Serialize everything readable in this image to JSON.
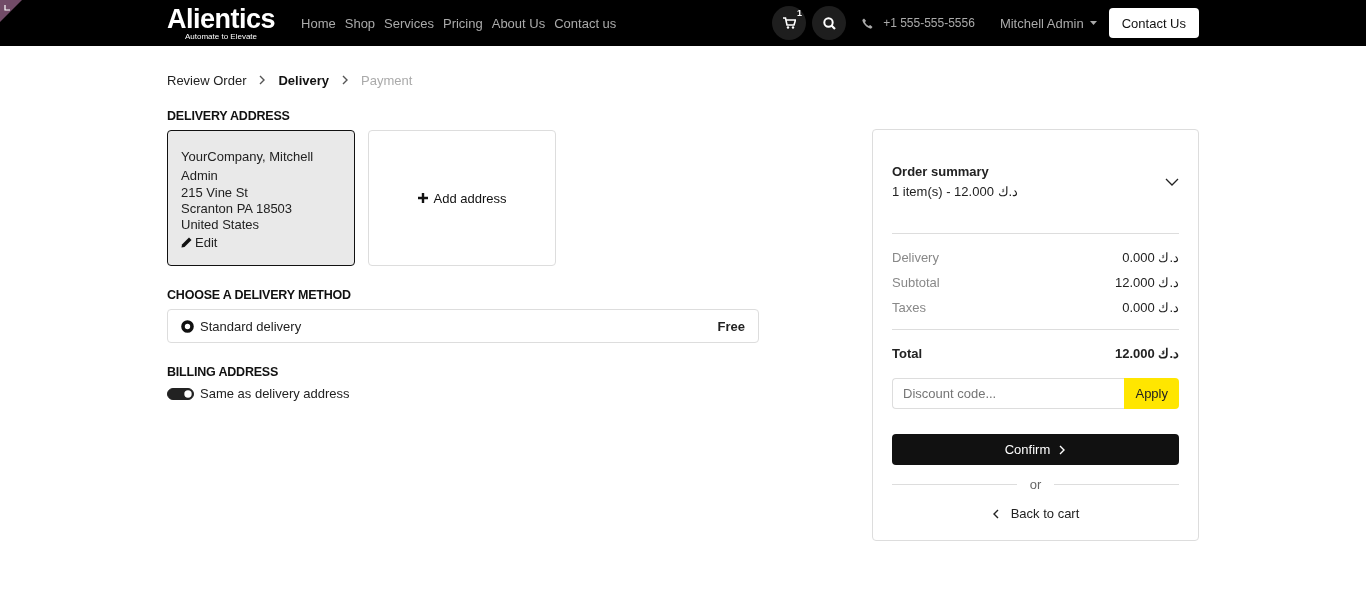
{
  "header": {
    "logo": {
      "name": "Alientics",
      "tagline": "Automate to Elevate"
    },
    "nav": [
      {
        "label": "Home"
      },
      {
        "label": "Shop"
      },
      {
        "label": "Services"
      },
      {
        "label": "Pricing"
      },
      {
        "label": "About Us"
      },
      {
        "label": "Contact us"
      }
    ],
    "cart_count": "1",
    "phone": "+1 555-555-5556",
    "user": "Mitchell Admin",
    "cta": "Contact Us"
  },
  "breadcrumb": [
    {
      "label": "Review Order",
      "selected": false,
      "disabled": false
    },
    {
      "label": "Delivery",
      "selected": true,
      "disabled": false
    },
    {
      "label": "Payment",
      "selected": false,
      "disabled": true
    }
  ],
  "delivery_address": {
    "title": "DELIVERY ADDRESS",
    "addresses": [
      {
        "lines": [
          "YourCompany, Mitchell Admin",
          "215 Vine St",
          "Scranton PA 18503",
          "United States"
        ],
        "edit": "Edit",
        "selected": true
      }
    ],
    "add_label": "Add address"
  },
  "delivery_method": {
    "title": "CHOOSE A DELIVERY METHOD",
    "options": [
      {
        "label": "Standard delivery",
        "price": "Free",
        "selected": true
      }
    ]
  },
  "billing": {
    "title": "BILLING ADDRESS",
    "same_as_delivery": {
      "label": "Same as delivery address",
      "on": true
    }
  },
  "summary": {
    "title": "Order summary",
    "items": "1 item(s) -  12.000 د.ك",
    "lines": [
      {
        "label": "Delivery",
        "amount": "0.000 د.ك"
      },
      {
        "label": "Subtotal",
        "amount": "12.000 د.ك"
      },
      {
        "label": "Taxes",
        "amount": "0.000 د.ك"
      }
    ],
    "total": {
      "label": "Total",
      "amount": "12.000 د.ك"
    },
    "discount": {
      "placeholder": "Discount code...",
      "button": "Apply"
    },
    "confirm": "Confirm",
    "or": "or",
    "back": "Back to cart"
  }
}
